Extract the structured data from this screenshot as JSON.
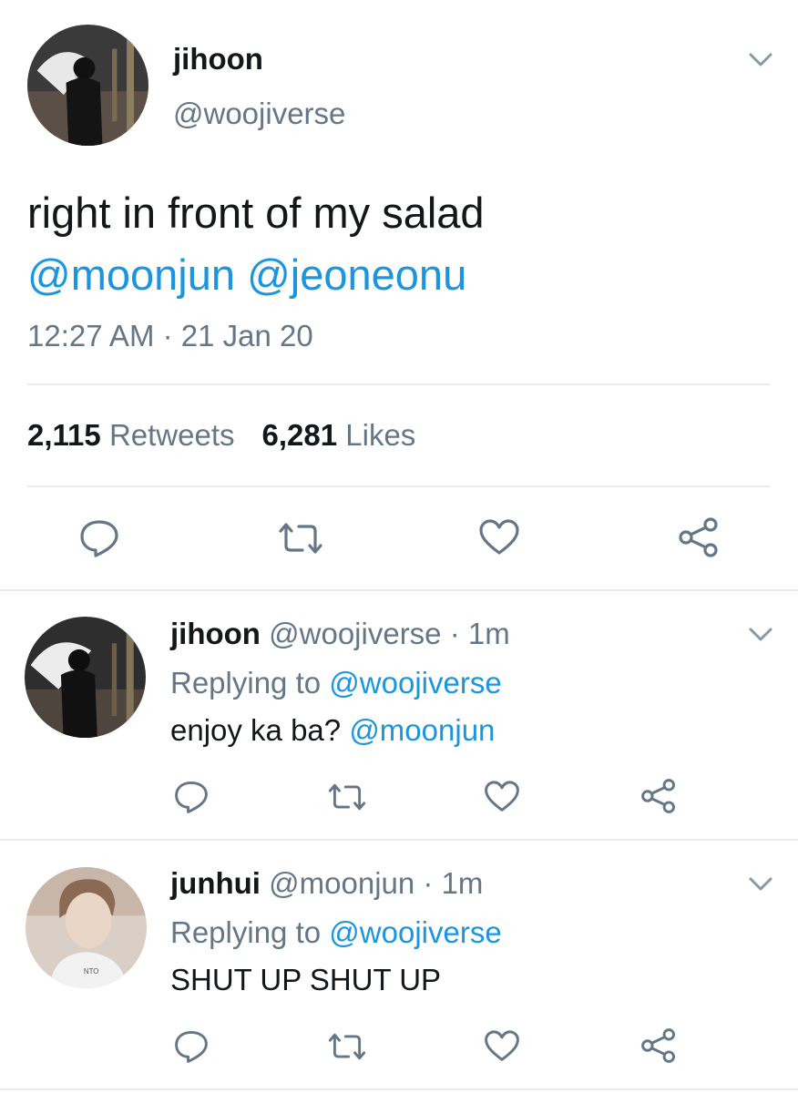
{
  "main_tweet": {
    "display_name": "jihoon",
    "handle": "@woojiverse",
    "text": "right in front of my salad",
    "mentions": [
      "@moonjun",
      "@jeoneonu"
    ],
    "timestamp": "12:27 AM · 21 Jan 20",
    "retweets_count": "2,115",
    "retweets_label": "Retweets",
    "likes_count": "6,281",
    "likes_label": "Likes",
    "icons": [
      "chevron-down-icon",
      "reply-icon",
      "retweet-icon",
      "like-icon",
      "share-icon"
    ]
  },
  "replies": [
    {
      "display_name": "jihoon",
      "handle": "@woojiverse",
      "time": "· 1m",
      "replying_label": "Replying to",
      "replying_to": "@woojiverse",
      "text": "enjoy ka ba?",
      "mention": "@moonjun"
    },
    {
      "display_name": "junhui",
      "handle": "@moonjun",
      "time": "· 1m",
      "replying_label": "Replying to",
      "replying_to": "@woojiverse",
      "text": "SHUT UP SHUT UP",
      "mention": ""
    }
  ],
  "colors": {
    "text": "#14171a",
    "secondary": "#657786",
    "link": "#1b95e0",
    "divider": "#e6ecf0",
    "icon": "#657786"
  }
}
